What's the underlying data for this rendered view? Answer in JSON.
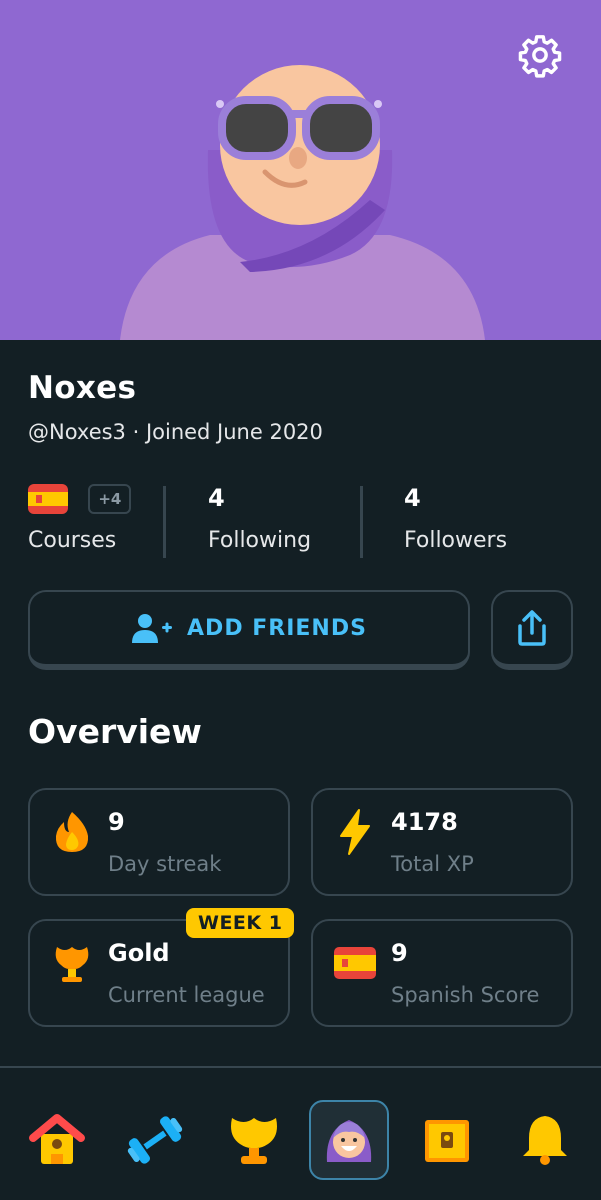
{
  "profile": {
    "name": "Noxes",
    "meta": "@Noxes3 · Joined June 2020"
  },
  "stats": {
    "courses_extra": "+4",
    "courses_label": "Courses",
    "following_value": "4",
    "following_label": "Following",
    "followers_value": "4",
    "followers_label": "Followers"
  },
  "actions": {
    "add_friends_label": "ADD FRIENDS"
  },
  "overview": {
    "title": "Overview",
    "streak_value": "9",
    "streak_label": "Day streak",
    "xp_value": "4178",
    "xp_label": "Total XP",
    "league_value": "Gold",
    "league_label": "Current league",
    "league_badge": "WEEK 1",
    "score_value": "9",
    "score_label": "Spanish Score"
  },
  "nav": [
    "home-icon",
    "dumbbell-icon",
    "trophy-icon",
    "profile-avatar-icon",
    "treasure-chest-icon",
    "bell-icon"
  ],
  "colors": {
    "background": "#131f24",
    "hero": "#8f68d1",
    "accent_blue": "#49c0f8",
    "border": "#37464f",
    "badge_gold": "#ffc800"
  }
}
